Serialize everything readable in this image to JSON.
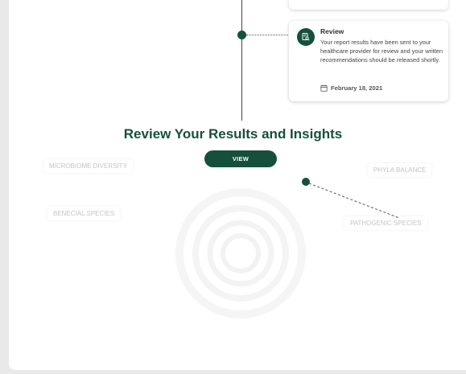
{
  "review_card": {
    "title": "Review",
    "body": "Your report results have been sent to your healthcare provider for review and your written recommendations should be released shortly.",
    "date": "February 18, 2021",
    "icon": "report-search-icon",
    "calendar_icon": "calendar-icon"
  },
  "section": {
    "title": "Review Your Results and Insights",
    "view_label": "VIEW"
  },
  "insights": {
    "microbiome_diversity": "MICROBIOME DIVERSITY",
    "phyla_balance": "PHYLA BALANCE",
    "benecial_species": "BENECIAL SPECIES",
    "pathogenic_species": "PATHOGENIC SPECIES"
  },
  "colors": {
    "accent": "#15503d",
    "muted_label": "#c4c4c4",
    "ring": "#f4f4f4"
  }
}
